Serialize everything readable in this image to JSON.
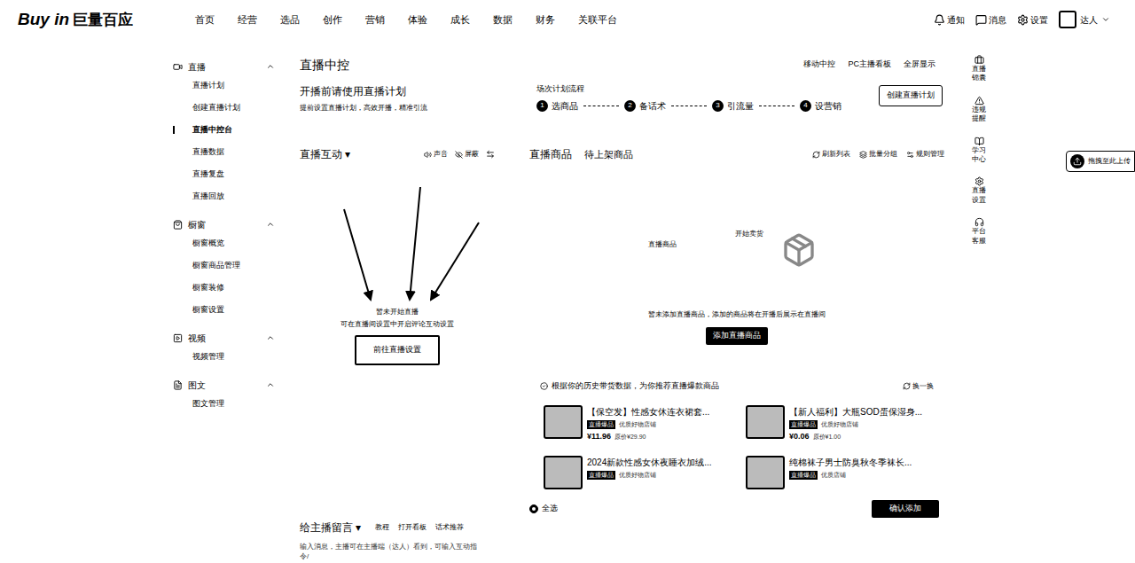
{
  "header": {
    "logo_en": "Buy in",
    "logo_cn": "巨量百应",
    "nav": [
      {
        "label": "首页",
        "selected": false
      },
      {
        "label": "经营",
        "selected": false
      },
      {
        "label": "选品",
        "selected": false
      },
      {
        "label": "创作",
        "selected": false
      },
      {
        "label": "营销",
        "selected": false
      },
      {
        "label": "体验",
        "selected": false
      },
      {
        "label": "成长",
        "selected": false
      },
      {
        "label": "数据",
        "selected": false
      },
      {
        "label": "财务",
        "selected": false
      },
      {
        "label": "关联平台",
        "selected": false
      }
    ],
    "actions": [
      "通知",
      "消息",
      "设置"
    ],
    "user": "达人"
  },
  "sidebar": {
    "groups": [
      {
        "label": "直播",
        "expanded": true,
        "items": [
          {
            "label": "直播计划",
            "selected": false
          },
          {
            "label": "创建直播计划",
            "selected": false
          },
          {
            "label": "直播中控台",
            "selected": true
          },
          {
            "label": "直播数据",
            "selected": false
          },
          {
            "label": "直播复盘",
            "selected": false
          },
          {
            "label": "直播回放",
            "selected": false
          }
        ]
      },
      {
        "label": "橱窗",
        "expanded": true,
        "items": [
          {
            "label": "橱窗概览",
            "selected": false
          },
          {
            "label": "橱窗商品管理",
            "selected": false
          },
          {
            "label": "橱窗装修",
            "selected": false
          },
          {
            "label": "橱窗设置",
            "selected": false
          }
        ]
      },
      {
        "label": "视频",
        "expanded": true,
        "items": [
          {
            "label": "视频管理",
            "selected": false
          }
        ]
      },
      {
        "label": "图文",
        "expanded": true,
        "items": [
          {
            "label": "图文管理",
            "selected": false
          }
        ]
      }
    ]
  },
  "page": {
    "title": "直播中控",
    "links": [
      "移动中控",
      "PC主播看板",
      "全屏显示"
    ]
  },
  "plan": {
    "title": "开播前请使用直播计划",
    "subtitle": "提前设置直播计划，高效开播，精准引流",
    "flow_label": "场次计划流程",
    "steps": [
      {
        "num": "1",
        "label": "选商品"
      },
      {
        "num": "2",
        "label": "备话术"
      },
      {
        "num": "3",
        "label": "引流量"
      },
      {
        "num": "4",
        "label": "设营销"
      }
    ],
    "button": "创建直播计划"
  },
  "interaction": {
    "title": "直播互动",
    "dropdown": "▾",
    "tools": [
      "声音",
      "屏蔽"
    ],
    "empty_title": "暂未开始直播",
    "empty_text": "可在直播间设置中开启评论互动设置",
    "button": "前往直播设置"
  },
  "message": {
    "title": "给主播留言",
    "dropdown": "▾",
    "links": [
      "教程",
      "打开看板",
      "话术推荐"
    ],
    "placeholder": "输入消息，主播可在主播端（达人）看到，可输入互动指令/"
  },
  "products": {
    "tabs": [
      {
        "label": "直播商品",
        "selected": true
      },
      {
        "label": "待上架商品",
        "selected": false
      }
    ],
    "actions": [
      "刷新列表",
      "批量分组",
      "规则管理"
    ],
    "illustration": {
      "label": "直播商品",
      "caption": "开始卖货"
    },
    "empty_text": "暂未添加直播商品，添加的商品将在开播后展示在直播间",
    "add_button": "添加直播商品"
  },
  "recommend": {
    "title": "根据你的历史带货数据，为你推荐直播爆款商品",
    "refresh": "换一换",
    "items": [
      {
        "title": "【保空发】性感女休连衣裙套...",
        "tag": "直播爆品",
        "shop": "优质好物店铺",
        "price": "¥11.96",
        "original_label": "原价",
        "original": "¥29.90"
      },
      {
        "title": "【新人福利】大瓶SOD蛋保湿身...",
        "tag": "直播爆品",
        "shop": "优质好物店铺",
        "price": "¥0.06",
        "original_label": "原价",
        "original": "¥1.00"
      },
      {
        "title": "2024新款性感女休夜睡衣加绒...",
        "tag": "直播爆品",
        "shop": "优质好物店铺",
        "price": "",
        "original_label": "",
        "original": ""
      },
      {
        "title": "纯棉袜子男士防臭秋冬季袜长...",
        "tag": "直播爆品",
        "shop": "优质店铺",
        "price": "",
        "original_label": "",
        "original": ""
      }
    ],
    "select_all": {
      "label": "全选",
      "checked": true
    },
    "confirm": "确认添加"
  },
  "rail": [
    "直播锦囊",
    "违规提醒",
    "学习中心",
    "直播设置",
    "平台客服"
  ],
  "upload_hint": "拖拽至此上传"
}
